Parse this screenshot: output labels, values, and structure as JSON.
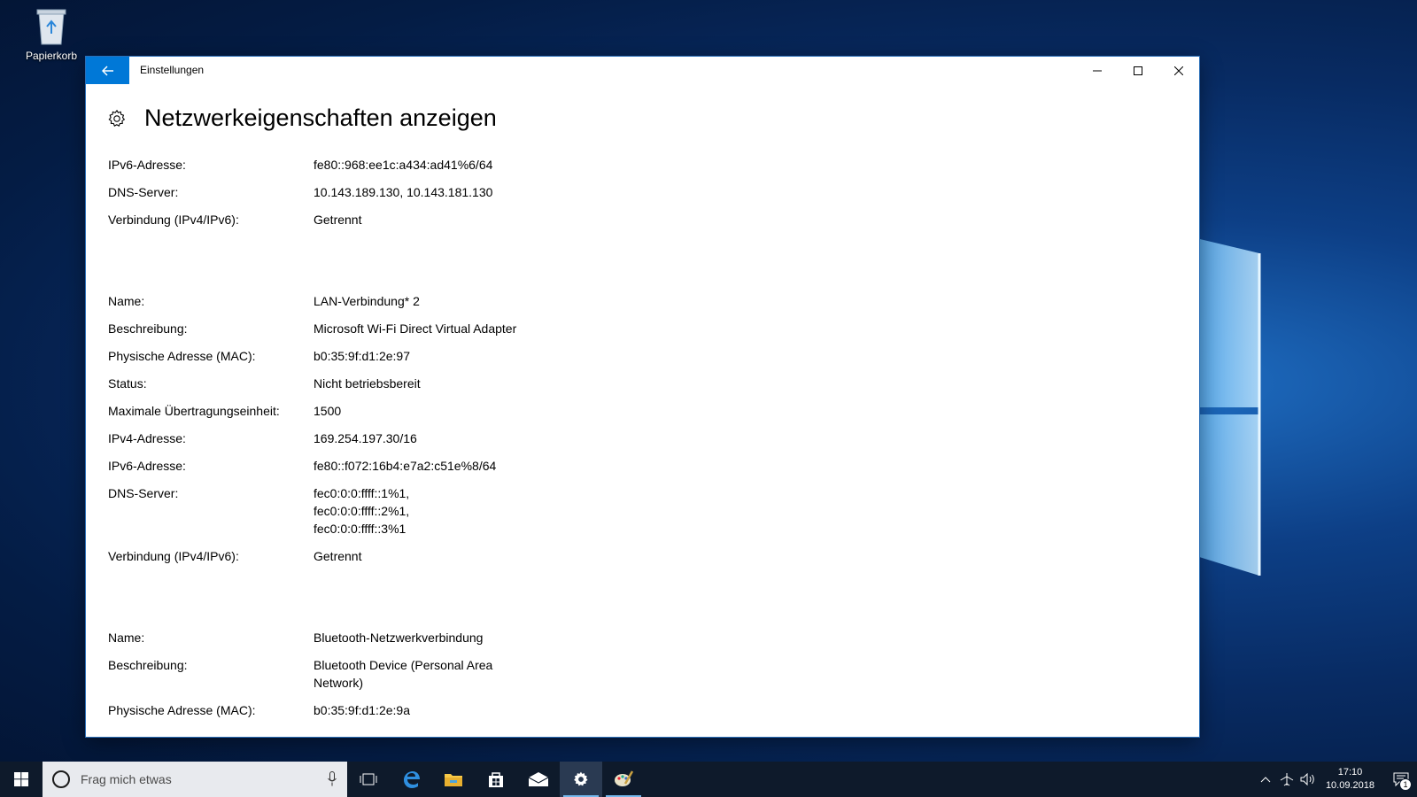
{
  "desktop": {
    "recycle_bin_label": "Papierkorb"
  },
  "window": {
    "title": "Einstellungen",
    "page_title": "Netzwerkeigenschaften anzeigen"
  },
  "properties": [
    {
      "label": "IPv6-Adresse:",
      "value": "fe80::968:ee1c:a434:ad41%6/64"
    },
    {
      "label": "DNS-Server:",
      "value": "10.143.189.130, 10.143.181.130"
    },
    {
      "label": "Verbindung (IPv4/IPv6):",
      "value": "Getrennt"
    },
    {
      "label": "Name:",
      "value": "LAN-Verbindung* 2"
    },
    {
      "label": "Beschreibung:",
      "value": "Microsoft Wi-Fi Direct Virtual Adapter"
    },
    {
      "label": "Physische Adresse (MAC):",
      "value": "b0:35:9f:d1:2e:97"
    },
    {
      "label": "Status:",
      "value": "Nicht betriebsbereit"
    },
    {
      "label": "Maximale Übertragungseinheit:",
      "value": "1500"
    },
    {
      "label": "IPv4-Adresse:",
      "value": "169.254.197.30/16"
    },
    {
      "label": "IPv6-Adresse:",
      "value": "fe80::f072:16b4:e7a2:c51e%8/64"
    },
    {
      "label": "DNS-Server:",
      "value": "fec0:0:0:ffff::1%1, fec0:0:0:ffff::2%1, fec0:0:0:ffff::3%1"
    },
    {
      "label": "Verbindung (IPv4/IPv6):",
      "value": "Getrennt"
    },
    {
      "label": "Name:",
      "value": "Bluetooth-Netzwerkverbindung"
    },
    {
      "label": "Beschreibung:",
      "value": "Bluetooth Device (Personal Area Network)"
    },
    {
      "label": "Physische Adresse (MAC):",
      "value": "b0:35:9f:d1:2e:9a"
    }
  ],
  "taskbar": {
    "search_placeholder": "Frag mich etwas",
    "apps": [
      "task-view-icon",
      "edge-icon",
      "file-explorer-icon",
      "store-icon",
      "mail-icon",
      "settings-icon",
      "paint-icon"
    ],
    "active_app": "settings-icon",
    "time": "17:10",
    "date": "10.09.2018",
    "notification_count": "1"
  },
  "colors": {
    "accent": "#0078d7",
    "taskbar": "#0e1a2b"
  }
}
